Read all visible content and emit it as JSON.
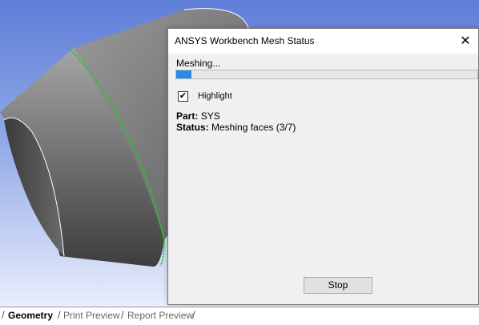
{
  "dialog": {
    "title": "ANSYS Workbench Mesh Status",
    "close_glyph": "✕",
    "meshing_label": "Meshing...",
    "progress_fraction": 0.05,
    "highlight": {
      "label": "Highlight",
      "checked": true,
      "check_glyph": "✔"
    },
    "part_label": "Part:",
    "part_value": "SYS",
    "status_label": "Status:",
    "status_value": "Meshing faces (3/7)",
    "stop_button": "Stop"
  },
  "tabs": [
    {
      "label": "Geometry",
      "active": true
    },
    {
      "label": "Print Preview",
      "active": false
    },
    {
      "label": "Report Preview",
      "active": false
    }
  ],
  "colors": {
    "progress_fill": "#2b8be2",
    "highlight_edge": "#22cc22",
    "viewport_top": "#5f7ed8",
    "viewport_bottom": "#e9eefb"
  }
}
